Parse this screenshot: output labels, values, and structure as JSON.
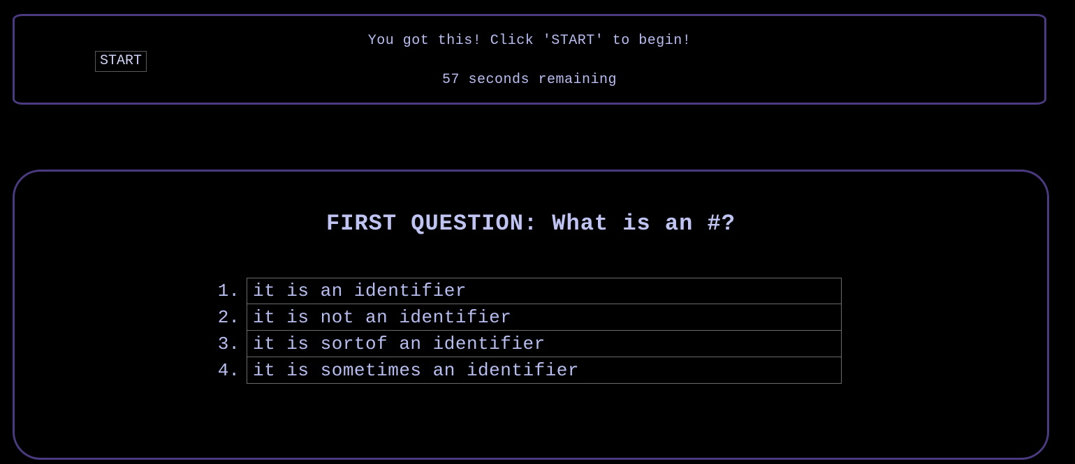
{
  "header": {
    "start_label": "START",
    "message": "You got this! Click 'START' to begin!",
    "timer_text": "57 seconds remaining"
  },
  "quiz": {
    "question": "FIRST QUESTION: What is an #?",
    "answers": [
      {
        "number": "1.",
        "text": "it is an identifier"
      },
      {
        "number": "2.",
        "text": "it is not an identifier"
      },
      {
        "number": "3.",
        "text": "it is sortof an identifier"
      },
      {
        "number": "4.",
        "text": "it is sometimes an identifier"
      }
    ]
  },
  "colors": {
    "background": "#000000",
    "panel_border": "#4b3a7f",
    "text": "#b8bdf0"
  }
}
